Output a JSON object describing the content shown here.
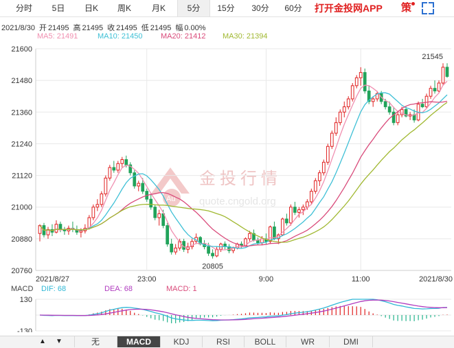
{
  "tabs": [
    {
      "label": "分时"
    },
    {
      "label": "5日"
    },
    {
      "label": "日K"
    },
    {
      "label": "周K"
    },
    {
      "label": "月K"
    },
    {
      "label": "5分"
    },
    {
      "label": "15分"
    },
    {
      "label": "30分"
    },
    {
      "label": "60分"
    }
  ],
  "active_tab": "5分",
  "promo_label": "打开金投网APP",
  "strategy_label": "策",
  "quote": {
    "date": "2021/8/30",
    "open_label": "开",
    "open": "21495",
    "high_label": "高",
    "high": "21495",
    "close_label": "收",
    "close": "21495",
    "low_label": "低",
    "low": "21495",
    "change_label": "幅",
    "change": "0.00%"
  },
  "ma": [
    {
      "label": "MA5: 21491",
      "color": "#f08fb0"
    },
    {
      "label": "MA10: 21450",
      "color": "#3fc0d6"
    },
    {
      "label": "MA20: 21412",
      "color": "#d94a7a"
    },
    {
      "label": "MA30: 21394",
      "color": "#a0b830"
    }
  ],
  "watermark": {
    "name": "金投行情",
    "url": "quote.cngold.org",
    "badge": "Au"
  },
  "colors": {
    "up": "#e02020",
    "down": "#21a35a",
    "grid": "#e8e8e8",
    "dif": "#2fb8d6",
    "dea": "#b03cbf"
  },
  "chart_data": {
    "type": "candlestick",
    "y_ticks": [
      "21600",
      "21480",
      "21360",
      "21240",
      "21120",
      "21000",
      "20880",
      "20760"
    ],
    "ylim": [
      20760,
      21600
    ],
    "x_ticks": [
      "2021/8/27",
      "23:00",
      "9:00",
      "11:00",
      "2021/8/30"
    ],
    "annotations": [
      {
        "label": "21545"
      },
      {
        "label": "20805"
      }
    ],
    "candles": [
      [
        20900,
        20935,
        20870,
        20930
      ],
      [
        20930,
        20940,
        20885,
        20895
      ],
      [
        20895,
        20925,
        20880,
        20915
      ],
      [
        20915,
        20935,
        20890,
        20905
      ],
      [
        20905,
        20950,
        20900,
        20935
      ],
      [
        20935,
        20945,
        20905,
        20915
      ],
      [
        20915,
        20925,
        20895,
        20910
      ],
      [
        20910,
        20930,
        20895,
        20920
      ],
      [
        20920,
        20945,
        20905,
        20915
      ],
      [
        20915,
        20930,
        20895,
        20905
      ],
      [
        20905,
        20920,
        20885,
        20910
      ],
      [
        20910,
        20935,
        20900,
        20920
      ],
      [
        20920,
        20970,
        20915,
        20960
      ],
      [
        20960,
        21010,
        20950,
        21000
      ],
      [
        21000,
        21030,
        20985,
        21010
      ],
      [
        21010,
        21060,
        21000,
        21050
      ],
      [
        21050,
        21120,
        21040,
        21110
      ],
      [
        21110,
        21160,
        21100,
        21150
      ],
      [
        21150,
        21175,
        21130,
        21140
      ],
      [
        21140,
        21175,
        21130,
        21165
      ],
      [
        21165,
        21190,
        21150,
        21180
      ],
      [
        21180,
        21195,
        21150,
        21160
      ],
      [
        21160,
        21170,
        21120,
        21130
      ],
      [
        21130,
        21140,
        21070,
        21080
      ],
      [
        21080,
        21100,
        21060,
        21090
      ],
      [
        21090,
        21110,
        21050,
        21060
      ],
      [
        21060,
        21070,
        21020,
        21030
      ],
      [
        21030,
        21050,
        20990,
        21000
      ],
      [
        21000,
        21010,
        20950,
        20960
      ],
      [
        20960,
        20990,
        20930,
        20975
      ],
      [
        20975,
        20990,
        20920,
        20930
      ],
      [
        20930,
        20940,
        20850,
        20860
      ],
      [
        20860,
        20880,
        20820,
        20830
      ],
      [
        20830,
        20860,
        20820,
        20845
      ],
      [
        20845,
        20880,
        20835,
        20870
      ],
      [
        20870,
        20880,
        20830,
        20840
      ],
      [
        20840,
        20865,
        20825,
        20850
      ],
      [
        20850,
        20880,
        20840,
        20870
      ],
      [
        20870,
        20900,
        20860,
        20885
      ],
      [
        20885,
        20890,
        20855,
        20860
      ],
      [
        20860,
        20875,
        20840,
        20850
      ],
      [
        20850,
        20865,
        20815,
        20825
      ],
      [
        20825,
        20840,
        20805,
        20815
      ],
      [
        20815,
        20850,
        20810,
        20840
      ],
      [
        20840,
        20865,
        20830,
        20860
      ],
      [
        20860,
        20870,
        20840,
        20850
      ],
      [
        20850,
        20860,
        20825,
        20835
      ],
      [
        20835,
        20850,
        20825,
        20845
      ],
      [
        20845,
        20865,
        20840,
        20860
      ],
      [
        20860,
        20870,
        20845,
        20855
      ],
      [
        20855,
        20885,
        20850,
        20880
      ],
      [
        20880,
        20910,
        20870,
        20900
      ],
      [
        20900,
        20915,
        20870,
        20875
      ],
      [
        20875,
        20885,
        20855,
        20865
      ],
      [
        20865,
        20890,
        20855,
        20880
      ],
      [
        20880,
        20900,
        20860,
        20870
      ],
      [
        20870,
        20930,
        20860,
        20925
      ],
      [
        20925,
        20945,
        20875,
        20880
      ],
      [
        20880,
        20900,
        20860,
        20895
      ],
      [
        20895,
        20960,
        20890,
        20955
      ],
      [
        20955,
        20975,
        20930,
        20940
      ],
      [
        20940,
        21010,
        20930,
        21000
      ],
      [
        21000,
        21020,
        20970,
        20980
      ],
      [
        20980,
        21000,
        20960,
        20990
      ],
      [
        20990,
        21010,
        20970,
        21000
      ],
      [
        21000,
        21030,
        20990,
        21020
      ],
      [
        21020,
        21070,
        21010,
        21060
      ],
      [
        21060,
        21110,
        21050,
        21100
      ],
      [
        21100,
        21140,
        21080,
        21130
      ],
      [
        21130,
        21180,
        21120,
        21170
      ],
      [
        21170,
        21240,
        21160,
        21230
      ],
      [
        21230,
        21290,
        21220,
        21280
      ],
      [
        21280,
        21340,
        21270,
        21320
      ],
      [
        21320,
        21370,
        21310,
        21360
      ],
      [
        21360,
        21400,
        21340,
        21380
      ],
      [
        21380,
        21420,
        21370,
        21410
      ],
      [
        21410,
        21470,
        21400,
        21460
      ],
      [
        21460,
        21500,
        21450,
        21490
      ],
      [
        21490,
        21530,
        21460,
        21510
      ],
      [
        21510,
        21525,
        21430,
        21440
      ],
      [
        21440,
        21460,
        21390,
        21400
      ],
      [
        21400,
        21420,
        21380,
        21410
      ],
      [
        21410,
        21440,
        21400,
        21430
      ],
      [
        21430,
        21440,
        21390,
        21400
      ],
      [
        21400,
        21410,
        21370,
        21380
      ],
      [
        21380,
        21400,
        21350,
        21360
      ],
      [
        21360,
        21380,
        21310,
        21320
      ],
      [
        21320,
        21360,
        21310,
        21350
      ],
      [
        21350,
        21380,
        21340,
        21370
      ],
      [
        21370,
        21380,
        21340,
        21345
      ],
      [
        21345,
        21360,
        21330,
        21350
      ],
      [
        21350,
        21370,
        21320,
        21330
      ],
      [
        21330,
        21400,
        21325,
        21390
      ],
      [
        21390,
        21410,
        21375,
        21380
      ],
      [
        21380,
        21430,
        21375,
        21420
      ],
      [
        21420,
        21460,
        21410,
        21450
      ],
      [
        21450,
        21480,
        21430,
        21440
      ],
      [
        21440,
        21480,
        21435,
        21470
      ],
      [
        21470,
        21545,
        21460,
        21530
      ],
      [
        21530,
        21545,
        21490,
        21495
      ]
    ],
    "macd": {
      "ylim": [
        -130,
        130
      ],
      "y_ticks": [
        "130",
        "-130"
      ],
      "legend": [
        {
          "label": "MACD",
          "color": "#444444"
        },
        {
          "label": "DIF: 68",
          "color": "#2fb8d6"
        },
        {
          "label": "DEA: 68",
          "color": "#b03cbf"
        },
        {
          "label": "MACD: 1",
          "color": "#d94a7a"
        }
      ]
    }
  },
  "indicator_tabs": [
    {
      "label": "无"
    },
    {
      "label": "MACD"
    },
    {
      "label": "KDJ"
    },
    {
      "label": "RSI"
    },
    {
      "label": "BOLL"
    },
    {
      "label": "WR"
    },
    {
      "label": "DMI"
    }
  ],
  "active_indicator": "MACD",
  "nav_up": "▲",
  "nav_down": "▼"
}
